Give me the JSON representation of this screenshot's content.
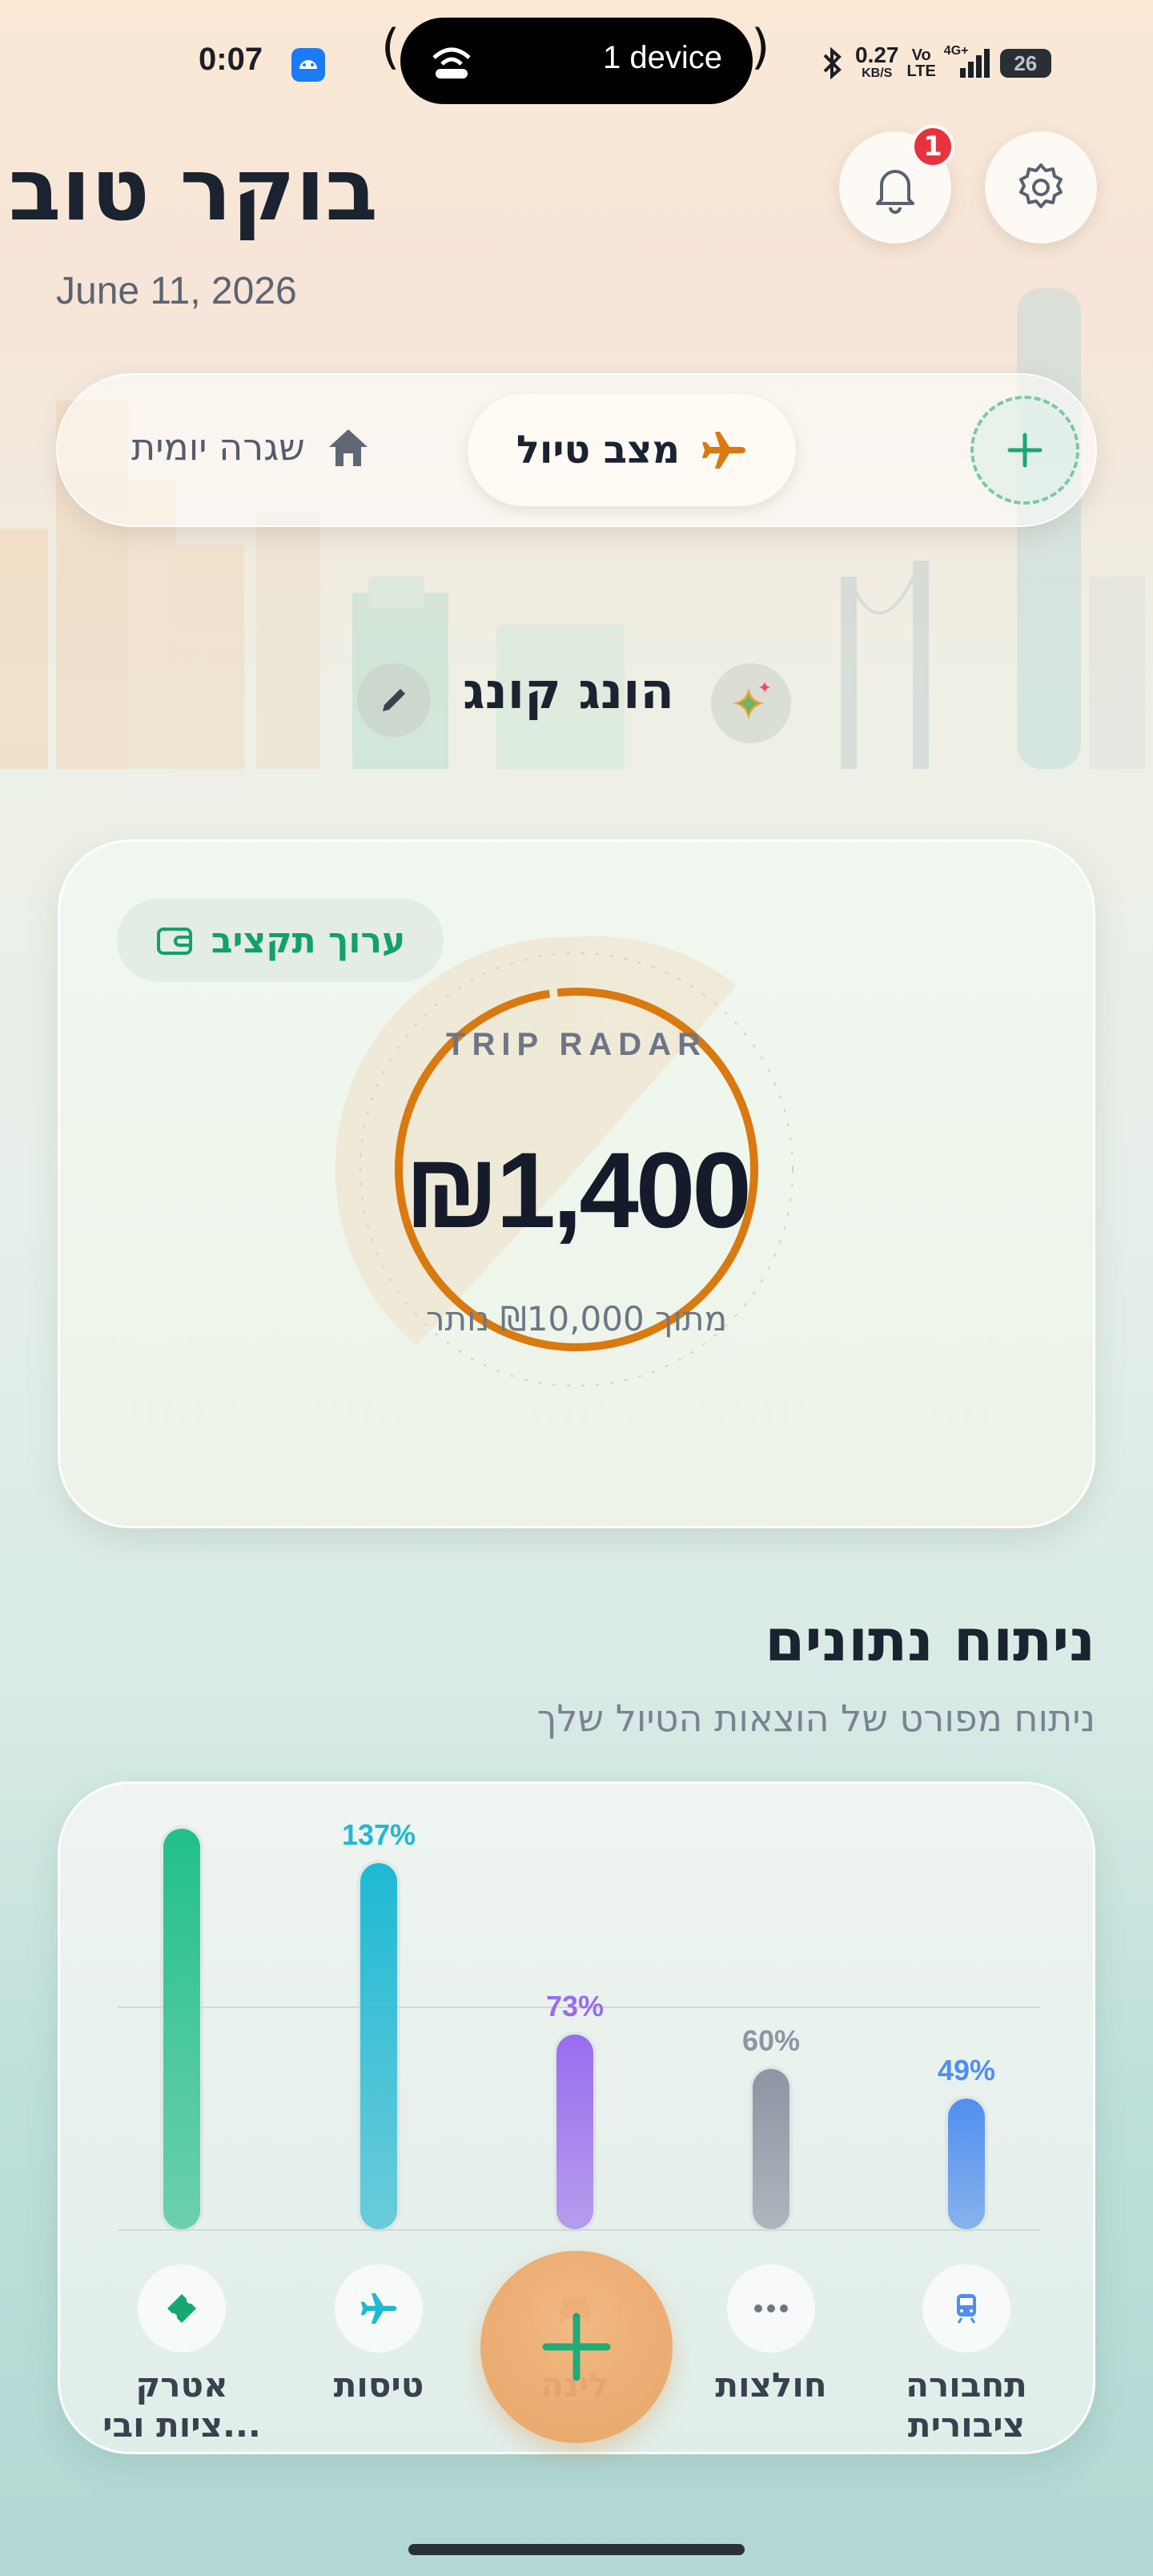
{
  "status_bar": {
    "time": "0:07",
    "hotspot_text": "1 device",
    "net_speed_value": "0.27",
    "net_speed_unit": "KB/S",
    "volte_top": "Vo",
    "volte_bottom": "LTE",
    "signal_label": "4G+",
    "battery": "26"
  },
  "header": {
    "greeting": "בוקר טוב",
    "date": "June 11, 2026",
    "notification_count": "1"
  },
  "mode_selector": {
    "active_label": "מצב טיול",
    "inactive_label": "שגרה יומית"
  },
  "destination": {
    "name": "הונג קונג"
  },
  "budget": {
    "edit_label": "ערוך תקציב",
    "radar_title": "TRIP RADAR",
    "amount": "₪1,400",
    "subtitle": "מתוך ₪10,000 נותר"
  },
  "analytics": {
    "title": "ניתוח נתונים",
    "subtitle": "ניתוח מפורט של הוצאות הטיול שלך",
    "categories": [
      {
        "label_line1": "תחבורה",
        "label_line2": "ציבורית",
        "percent_text": "49%",
        "percent": 49,
        "color": "#4f8ff0",
        "icon": "train-icon"
      },
      {
        "label_line1": "חולצות",
        "label_line2": "",
        "percent_text": "60%",
        "percent": 60,
        "color": "#8e95a3",
        "icon": "dots-icon"
      },
      {
        "label_line1": "לינה",
        "label_line2": "",
        "percent_text": "73%",
        "percent": 73,
        "color": "#9a6cf0",
        "icon": "bed-icon"
      },
      {
        "label_line1": "טיסות",
        "label_line2": "",
        "percent_text": "137%",
        "percent": 137,
        "color": "#1eb9d4",
        "icon": "plane-icon"
      },
      {
        "label_line1": "אטרק",
        "label_line2": "ציות ובי...",
        "percent_text": "",
        "percent": 150,
        "color": "#22c08a",
        "icon": "ticket-icon"
      }
    ]
  },
  "colors": {
    "accent_green": "#13a06a",
    "accent_orange": "#d9790f",
    "badge_red": "#e8333c",
    "fab_orange": "#e9a262"
  }
}
